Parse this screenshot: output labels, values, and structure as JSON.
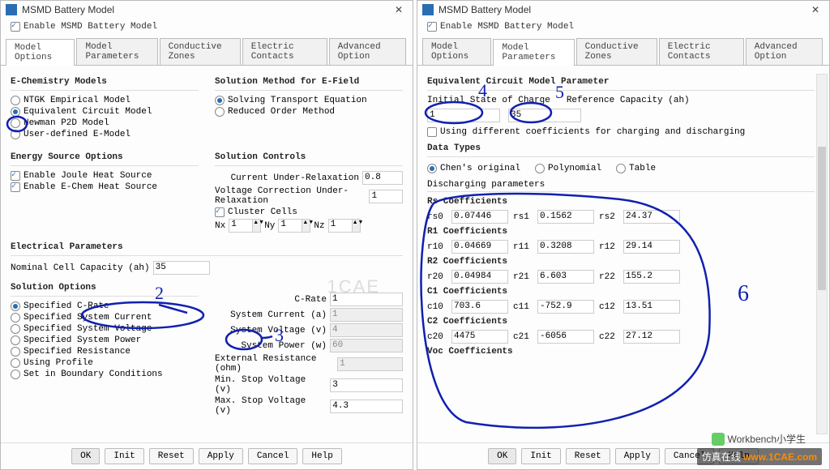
{
  "left": {
    "title": "MSMD Battery Model",
    "enable": "Enable MSMD Battery Model",
    "tabs": [
      "Model Options",
      "Model Parameters",
      "Conductive Zones",
      "Electric Contacts",
      "Advanced Option"
    ],
    "activeTab": 0,
    "echem": {
      "heading": "E-Chemistry Models",
      "items": [
        "NTGK Empirical Model",
        "Equivalent Circuit Model",
        "Newman P2D Model",
        "User-defined E-Model"
      ],
      "selected": 1
    },
    "solMethod": {
      "heading": "Solution Method for E-Field",
      "items": [
        "Solving Transport Equation",
        "Reduced Order Method"
      ],
      "selected": 0
    },
    "energy": {
      "heading": "Energy Source Options",
      "joule": "Enable Joule Heat Source",
      "echem": "Enable E-Chem Heat Source"
    },
    "solCtrl": {
      "heading": "Solution Controls",
      "curLabel": "Current Under-Relaxation",
      "curVal": "0.8",
      "voltLabel": "Voltage Correction Under-Relaxation",
      "voltVal": "1",
      "cluster": "Cluster Cells",
      "nxL": "Nx",
      "nxV": "1",
      "nyL": "Ny",
      "nyV": "1",
      "nzL": "Nz",
      "nzV": "1"
    },
    "elec": {
      "heading": "Electrical Parameters",
      "nomLabel": "Nominal Cell Capacity (ah)",
      "nomVal": "35"
    },
    "solOpt": {
      "heading": "Solution Options",
      "items": [
        "Specified C-Rate",
        "Specified System Current",
        "Specified System Voltage",
        "Specified System Power",
        "Specified Resistance",
        "Using Profile",
        "Set in Boundary Conditions"
      ],
      "selected": 0,
      "crateL": "C-Rate",
      "crateV": "1",
      "sysCurL": "System Current (a)",
      "sysCurV": "1",
      "sysVoltL": "System Voltage (v)",
      "sysVoltV": "4",
      "sysPowL": "System Power (w)",
      "sysPowV": "60",
      "extResL": "External Resistance (ohm)",
      "extResV": "1",
      "minStopL": "Min. Stop Voltage (v)",
      "minStopV": "3",
      "maxStopL": "Max. Stop Voltage (v)",
      "maxStopV": "4.3"
    },
    "buttons": [
      "OK",
      "Init",
      "Reset",
      "Apply",
      "Cancel",
      "Help"
    ],
    "ann2": "2",
    "ann3": "3"
  },
  "right": {
    "title": "MSMD Battery Model",
    "enable": "Enable MSMD Battery Model",
    "tabs": [
      "Model Options",
      "Model Parameters",
      "Conductive Zones",
      "Electric Contacts",
      "Advanced Option"
    ],
    "activeTab": 1,
    "eqHeading": "Equivalent Circuit Model Parameter",
    "isocL": "Initial State of Charge",
    "refCapL": "Reference Capacity (ah)",
    "isocV": "1",
    "refCapV": "35",
    "diffCoef": "Using different coefficients for charging and discharging",
    "dtHeading": "Data Types",
    "dtItems": [
      "Chen's original",
      "Polynomial",
      "Table"
    ],
    "dtSelected": 0,
    "dischHeading": "Discharging parameters",
    "rs": {
      "title": "Rs Coefficients",
      "l0": "rs0",
      "v0": "0.07446",
      "l1": "rs1",
      "v1": "0.1562",
      "l2": "rs2",
      "v2": "24.37"
    },
    "r1": {
      "title": "R1 Coefficients",
      "l0": "r10",
      "v0": "0.04669",
      "l1": "r11",
      "v1": "0.3208",
      "l2": "r12",
      "v2": "29.14"
    },
    "r2": {
      "title": "R2 Coefficients",
      "l0": "r20",
      "v0": "0.04984",
      "l1": "r21",
      "v1": "6.603",
      "l2": "r22",
      "v2": "155.2"
    },
    "c1": {
      "title": "C1 Coefficients",
      "l0": "c10",
      "v0": "703.6",
      "l1": "c11",
      "v1": "-752.9",
      "l2": "c12",
      "v2": "13.51"
    },
    "c2": {
      "title": "C2 Coefficients",
      "l0": "c20",
      "v0": "4475",
      "l1": "c21",
      "v1": "-6056",
      "l2": "c22",
      "v2": "27.12"
    },
    "voc": "Voc Coefficients",
    "buttons": [
      "OK",
      "Init",
      "Reset",
      "Apply",
      "Cancel",
      "Help"
    ],
    "ann4": "4",
    "ann5": "5",
    "ann6": "6"
  },
  "watermark1": "1CAE",
  "watermark2": "Workbench小学生",
  "watermark3a": "仿真在线",
  "watermark3b": "www.1CAE.com"
}
